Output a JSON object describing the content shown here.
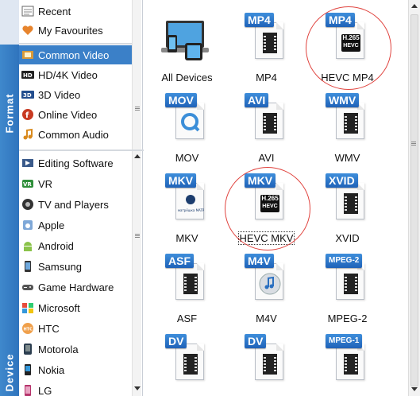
{
  "sections": {
    "format_tab": "Format",
    "device_tab": "Device"
  },
  "format_items": [
    {
      "label": "Recent",
      "icon": "recent-icon"
    },
    {
      "label": "My Favourites",
      "icon": "heart-icon"
    },
    {
      "label": "Common Video",
      "icon": "film-icon",
      "selected": true
    },
    {
      "label": "HD/4K Video",
      "icon": "hd-icon"
    },
    {
      "label": "3D Video",
      "icon": "3d-icon"
    },
    {
      "label": "Online Video",
      "icon": "flash-icon"
    },
    {
      "label": "Common Audio",
      "icon": "music-note-icon"
    }
  ],
  "device_items": [
    {
      "label": "Editing Software",
      "icon": "editing-icon"
    },
    {
      "label": "VR",
      "icon": "vr-icon"
    },
    {
      "label": "TV and Players",
      "icon": "tv-icon"
    },
    {
      "label": "Apple",
      "icon": "apple-icon"
    },
    {
      "label": "Android",
      "icon": "android-icon"
    },
    {
      "label": "Samsung",
      "icon": "samsung-icon"
    },
    {
      "label": "Game Hardware",
      "icon": "gamepad-icon"
    },
    {
      "label": "Microsoft",
      "icon": "windows-icon"
    },
    {
      "label": "HTC",
      "icon": "htc-icon"
    },
    {
      "label": "Motorola",
      "icon": "motorola-icon"
    },
    {
      "label": "Nokia",
      "icon": "nokia-icon"
    },
    {
      "label": "LG",
      "icon": "lg-icon"
    }
  ],
  "formats": [
    {
      "label": "All Devices",
      "badge": "",
      "kind": "devices"
    },
    {
      "label": "MP4",
      "badge": "MP4",
      "kind": "film"
    },
    {
      "label": "HEVC MP4",
      "badge": "MP4",
      "kind": "hevc",
      "hevc_text": "H.265",
      "hevc_sub": "HEVC",
      "circled": true
    },
    {
      "label": "MOV",
      "badge": "MOV",
      "kind": "quicktime"
    },
    {
      "label": "AVI",
      "badge": "AVI",
      "kind": "film"
    },
    {
      "label": "WMV",
      "badge": "WMV",
      "kind": "film"
    },
    {
      "label": "MKV",
      "badge": "MKV",
      "kind": "matroska",
      "sub": "матрёшка MATROSKA"
    },
    {
      "label": "HEVC MKV",
      "badge": "MKV",
      "kind": "hevc",
      "hevc_text": "H.265",
      "hevc_sub": "HEVC",
      "circled": true,
      "focused": true
    },
    {
      "label": "XVID",
      "badge": "XVID",
      "kind": "film"
    },
    {
      "label": "ASF",
      "badge": "ASF",
      "kind": "film"
    },
    {
      "label": "M4V",
      "badge": "M4V",
      "kind": "music"
    },
    {
      "label": "MPEG-2",
      "badge": "MPEG-2",
      "kind": "film",
      "small": true
    },
    {
      "label": "",
      "badge": "DV",
      "kind": "film"
    },
    {
      "label": "",
      "badge": "DV",
      "kind": "film"
    },
    {
      "label": "",
      "badge": "MPEG-1",
      "kind": "film",
      "small": true
    }
  ],
  "colors": {
    "accent": "#3b80c8",
    "highlight_circle": "#e0443f"
  }
}
